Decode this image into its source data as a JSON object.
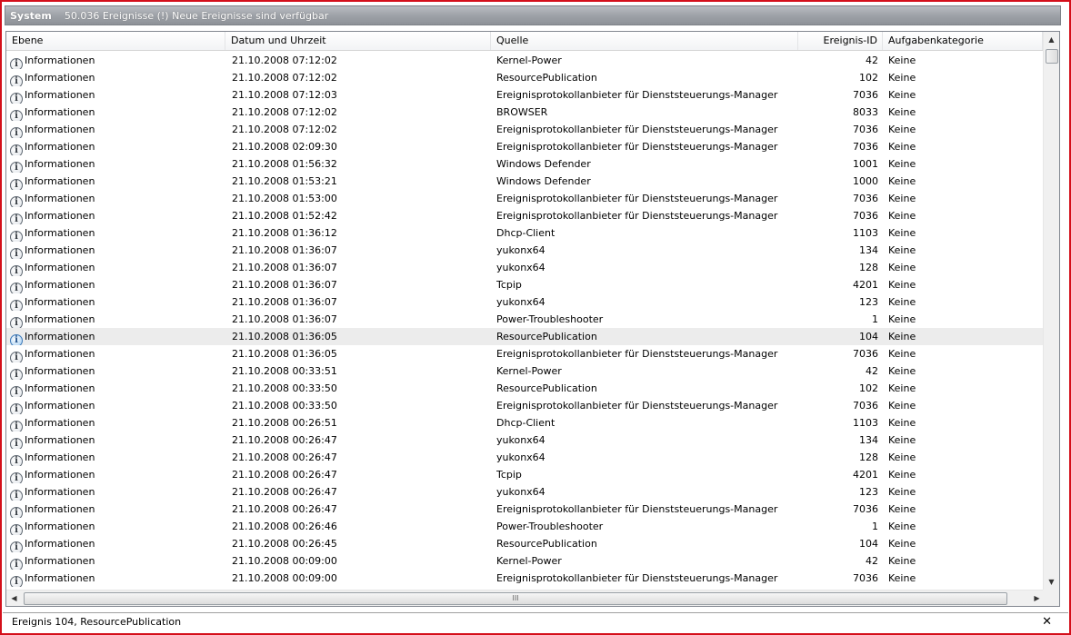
{
  "window": {
    "title": "System",
    "subtitle": "50.036 Ereignisse (!) Neue Ereignisse sind verfügbar"
  },
  "columns": {
    "level": "Ebene",
    "date": "Datum und Uhrzeit",
    "source": "Quelle",
    "id": "Ereignis-ID",
    "category": "Aufgabenkategorie"
  },
  "icons": {
    "info": "info-icon",
    "info_glyph": "i",
    "scroll_up": "▲",
    "scroll_down": "▼",
    "scroll_left": "◀",
    "scroll_right": "▶",
    "grip": "III",
    "close": "✕"
  },
  "selected_row_index": 16,
  "rows": [
    {
      "level": "Informationen",
      "date": "21.10.2008 07:12:02",
      "source": "Kernel-Power",
      "id": "42",
      "category": "Keine"
    },
    {
      "level": "Informationen",
      "date": "21.10.2008 07:12:02",
      "source": "ResourcePublication",
      "id": "102",
      "category": "Keine"
    },
    {
      "level": "Informationen",
      "date": "21.10.2008 07:12:03",
      "source": "Ereignisprotokollanbieter für Dienststeuerungs-Manager",
      "id": "7036",
      "category": "Keine"
    },
    {
      "level": "Informationen",
      "date": "21.10.2008 07:12:02",
      "source": "BROWSER",
      "id": "8033",
      "category": "Keine"
    },
    {
      "level": "Informationen",
      "date": "21.10.2008 07:12:02",
      "source": "Ereignisprotokollanbieter für Dienststeuerungs-Manager",
      "id": "7036",
      "category": "Keine"
    },
    {
      "level": "Informationen",
      "date": "21.10.2008 02:09:30",
      "source": "Ereignisprotokollanbieter für Dienststeuerungs-Manager",
      "id": "7036",
      "category": "Keine"
    },
    {
      "level": "Informationen",
      "date": "21.10.2008 01:56:32",
      "source": "Windows Defender",
      "id": "1001",
      "category": "Keine"
    },
    {
      "level": "Informationen",
      "date": "21.10.2008 01:53:21",
      "source": "Windows Defender",
      "id": "1000",
      "category": "Keine"
    },
    {
      "level": "Informationen",
      "date": "21.10.2008 01:53:00",
      "source": "Ereignisprotokollanbieter für Dienststeuerungs-Manager",
      "id": "7036",
      "category": "Keine"
    },
    {
      "level": "Informationen",
      "date": "21.10.2008 01:52:42",
      "source": "Ereignisprotokollanbieter für Dienststeuerungs-Manager",
      "id": "7036",
      "category": "Keine"
    },
    {
      "level": "Informationen",
      "date": "21.10.2008 01:36:12",
      "source": "Dhcp-Client",
      "id": "1103",
      "category": "Keine"
    },
    {
      "level": "Informationen",
      "date": "21.10.2008 01:36:07",
      "source": "yukonx64",
      "id": "134",
      "category": "Keine"
    },
    {
      "level": "Informationen",
      "date": "21.10.2008 01:36:07",
      "source": "yukonx64",
      "id": "128",
      "category": "Keine"
    },
    {
      "level": "Informationen",
      "date": "21.10.2008 01:36:07",
      "source": "Tcpip",
      "id": "4201",
      "category": "Keine"
    },
    {
      "level": "Informationen",
      "date": "21.10.2008 01:36:07",
      "source": "yukonx64",
      "id": "123",
      "category": "Keine"
    },
    {
      "level": "Informationen",
      "date": "21.10.2008 01:36:07",
      "source": "Power-Troubleshooter",
      "id": "1",
      "category": "Keine"
    },
    {
      "level": "Informationen",
      "date": "21.10.2008 01:36:05",
      "source": "ResourcePublication",
      "id": "104",
      "category": "Keine"
    },
    {
      "level": "Informationen",
      "date": "21.10.2008 01:36:05",
      "source": "Ereignisprotokollanbieter für Dienststeuerungs-Manager",
      "id": "7036",
      "category": "Keine"
    },
    {
      "level": "Informationen",
      "date": "21.10.2008 00:33:51",
      "source": "Kernel-Power",
      "id": "42",
      "category": "Keine"
    },
    {
      "level": "Informationen",
      "date": "21.10.2008 00:33:50",
      "source": "ResourcePublication",
      "id": "102",
      "category": "Keine"
    },
    {
      "level": "Informationen",
      "date": "21.10.2008 00:33:50",
      "source": "Ereignisprotokollanbieter für Dienststeuerungs-Manager",
      "id": "7036",
      "category": "Keine"
    },
    {
      "level": "Informationen",
      "date": "21.10.2008 00:26:51",
      "source": "Dhcp-Client",
      "id": "1103",
      "category": "Keine"
    },
    {
      "level": "Informationen",
      "date": "21.10.2008 00:26:47",
      "source": "yukonx64",
      "id": "134",
      "category": "Keine"
    },
    {
      "level": "Informationen",
      "date": "21.10.2008 00:26:47",
      "source": "yukonx64",
      "id": "128",
      "category": "Keine"
    },
    {
      "level": "Informationen",
      "date": "21.10.2008 00:26:47",
      "source": "Tcpip",
      "id": "4201",
      "category": "Keine"
    },
    {
      "level": "Informationen",
      "date": "21.10.2008 00:26:47",
      "source": "yukonx64",
      "id": "123",
      "category": "Keine"
    },
    {
      "level": "Informationen",
      "date": "21.10.2008 00:26:47",
      "source": "Ereignisprotokollanbieter für Dienststeuerungs-Manager",
      "id": "7036",
      "category": "Keine"
    },
    {
      "level": "Informationen",
      "date": "21.10.2008 00:26:46",
      "source": "Power-Troubleshooter",
      "id": "1",
      "category": "Keine"
    },
    {
      "level": "Informationen",
      "date": "21.10.2008 00:26:45",
      "source": "ResourcePublication",
      "id": "104",
      "category": "Keine"
    },
    {
      "level": "Informationen",
      "date": "21.10.2008 00:09:00",
      "source": "Kernel-Power",
      "id": "42",
      "category": "Keine"
    },
    {
      "level": "Informationen",
      "date": "21.10.2008 00:09:00",
      "source": "Ereignisprotokollanbieter für Dienststeuerungs-Manager",
      "id": "7036",
      "category": "Keine"
    }
  ],
  "detail": {
    "text": "Ereignis 104, ResourcePublication"
  },
  "colors": {
    "frame": "#d40f1a",
    "selected_row": "#ececec"
  }
}
